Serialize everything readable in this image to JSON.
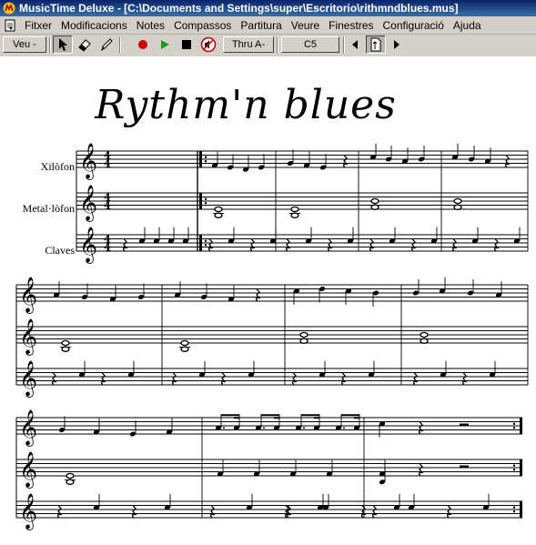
{
  "window": {
    "title": "MusicTime Deluxe - [C:\\Documents and Settings\\super\\Escritorio\\rithmndblues.mus]"
  },
  "menu": {
    "items": [
      "Fitxer",
      "Modificacions",
      "Notes",
      "Compassos",
      "Partitura",
      "Veure",
      "Finestres",
      "Configuració",
      "Ajuda"
    ]
  },
  "toolbar": {
    "voice_dropdown": "Veu -",
    "thru_dropdown": "Thru A-",
    "note_display": "C5",
    "tools": [
      "arrow-pointer-icon",
      "eraser-icon",
      "pencil-icon",
      "record-icon",
      "play-icon",
      "stop-icon",
      "speaker-mute-icon",
      "prev-page-icon",
      "page-icon",
      "next-page-icon"
    ]
  },
  "score": {
    "title": "Rythm'n blues",
    "instruments": [
      "Xilòfon",
      "Metal·lòfon",
      "Claves"
    ],
    "time_signature": {
      "numerator": "4",
      "denominator": "4"
    }
  },
  "colors": {
    "title_bar": "#0a246a",
    "chrome": "#d4d0c8",
    "record": "#cc0000",
    "play": "#1a9a1a"
  }
}
